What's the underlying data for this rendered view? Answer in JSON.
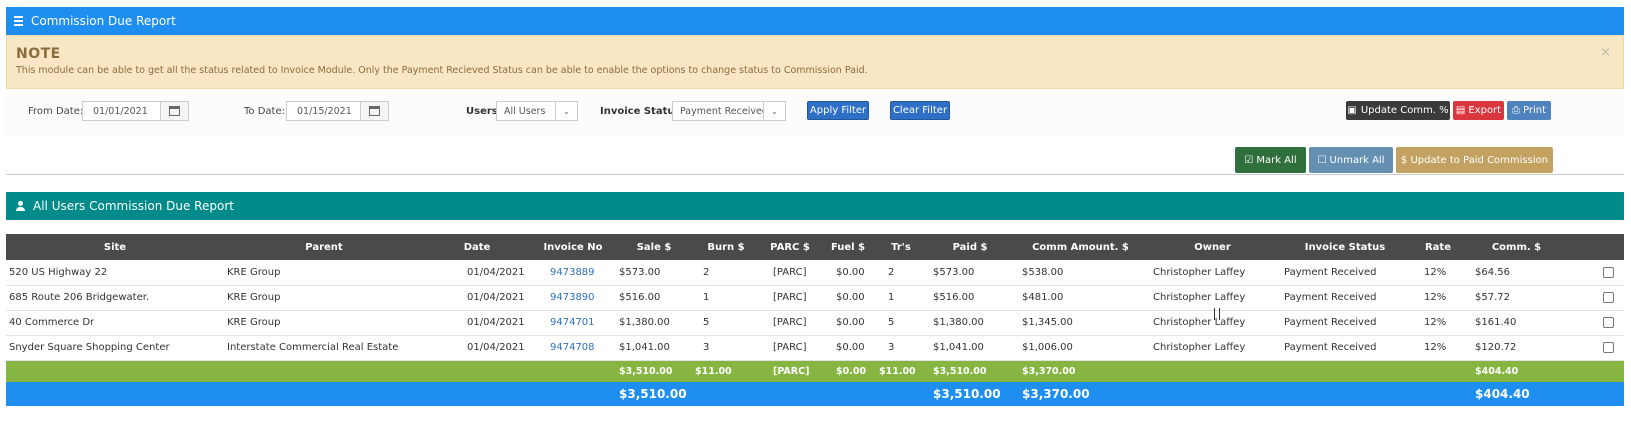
{
  "header": {
    "title": "Commission Due Report"
  },
  "note": {
    "title": "NOTE",
    "text": "This module can be able to get all the status related to Invoice Module. Only the Payment Recieved Status can be able to enable the options to change status to Commission Paid.",
    "close": "×"
  },
  "filters": {
    "from_label": "From Date:",
    "from_value": "01/01/2021",
    "to_label": "To Date:",
    "to_value": "01/15/2021",
    "users_label": "Users",
    "users_value": "All Users",
    "status_label": "Invoice Status",
    "status_value": "Payment Received",
    "apply_label": "Apply Filter",
    "clear_label": "Clear Filter",
    "update_comm_label": "Update Comm. %",
    "export_label": "Export",
    "print_label": "Print"
  },
  "actions": {
    "mark_all": "Mark All",
    "unmark_all": "Unmark All",
    "update_paid": "$ Update to Paid Commission"
  },
  "section": {
    "title": "All Users Commission Due Report"
  },
  "table": {
    "headers": [
      "Site",
      "Parent",
      "Date",
      "Invoice No",
      "Sale $",
      "Burn $",
      "PARC $",
      "Fuel $",
      "Tr's",
      "Paid $",
      "Comm Amount. $",
      "Owner",
      "Invoice Status",
      "Rate",
      "Comm. $",
      ""
    ],
    "rows": [
      [
        "520 US Highway 22",
        "KRE Group",
        "01/04/2021",
        "9473889",
        "$573.00",
        "2",
        "[PARC]",
        "$0.00",
        "2",
        "$573.00",
        "$538.00",
        "Christopher Laffey",
        "Payment Received",
        "12%",
        "$64.56"
      ],
      [
        "685 Route 206 Bridgewater.",
        "KRE Group",
        "01/04/2021",
        "9473890",
        "$516.00",
        "1",
        "[PARC]",
        "$0.00",
        "1",
        "$516.00",
        "$481.00",
        "Christopher Laffey",
        "Payment Received",
        "12%",
        "$57.72"
      ],
      [
        "40 Commerce Dr",
        "KRE Group",
        "01/04/2021",
        "9474701",
        "$1,380.00",
        "5",
        "[PARC]",
        "$0.00",
        "5",
        "$1,380.00",
        "$1,345.00",
        "Christopher Laffey",
        "Payment Received",
        "12%",
        "$161.40"
      ],
      [
        "Snyder Square Shopping Center",
        "Interstate Commercial Real Estate",
        "01/04/2021",
        "9474708",
        "$1,041.00",
        "3",
        "[PARC]",
        "$0.00",
        "3",
        "$1,041.00",
        "$1,006.00",
        "Christopher Laffey",
        "Payment Received",
        "12%",
        "$120.72"
      ]
    ],
    "subtotal": {
      "sale": "$3,510.00",
      "burn": "$11.00",
      "parc": "[PARC]",
      "fuel": "$0.00",
      "trs": "$11.00",
      "paid": "$3,510.00",
      "comm_amount": "$3,370.00",
      "comm": "$404.40"
    },
    "total": {
      "sale": "$3,510.00",
      "paid": "$3,510.00",
      "comm_amount": "$3,370.00",
      "comm": "$404.40"
    }
  }
}
